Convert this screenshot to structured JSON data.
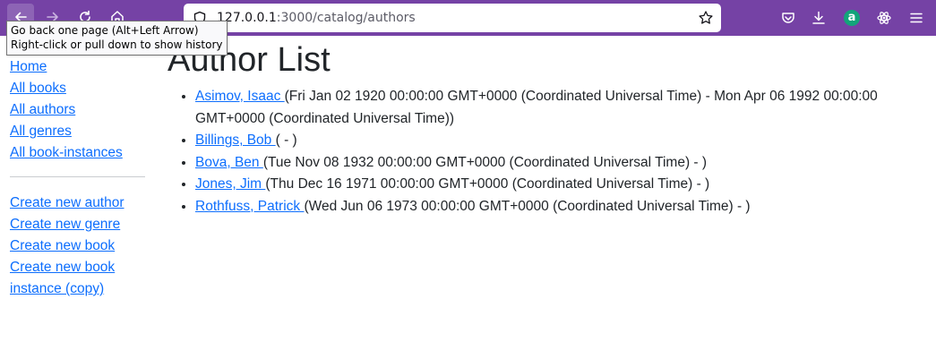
{
  "browser": {
    "url_host": "127.0.0.1",
    "url_rest": ":3000/catalog/authors",
    "tooltip_line1": "Go back one page (Alt+Left Arrow)",
    "tooltip_line2": "Right-click or pull down to show history",
    "extension_letter": "a",
    "toolbar_color": "#7542a5"
  },
  "sidebar": {
    "links": [
      "Home",
      "All books",
      "All authors",
      "All genres",
      "All book-instances"
    ],
    "create_links": [
      "Create new author",
      "Create new genre",
      "Create new book",
      "Create new book instance (copy)"
    ]
  },
  "page": {
    "title": "Author List",
    "authors": [
      {
        "name": "Asimov, Isaac ",
        "dates": "(Fri Jan 02 1920 00:00:00 GMT+0000 (Coordinated Universal Time) - Mon Apr 06 1992 00:00:00 GMT+0000 (Coordinated Universal Time))"
      },
      {
        "name": "Billings, Bob ",
        "dates": "( - )"
      },
      {
        "name": "Bova, Ben ",
        "dates": "(Tue Nov 08 1932 00:00:00 GMT+0000 (Coordinated Universal Time) - )"
      },
      {
        "name": "Jones, Jim ",
        "dates": "(Thu Dec 16 1971 00:00:00 GMT+0000 (Coordinated Universal Time) - )"
      },
      {
        "name": "Rothfuss, Patrick ",
        "dates": "(Wed Jun 06 1973 00:00:00 GMT+0000 (Coordinated Universal Time) - )"
      }
    ]
  }
}
